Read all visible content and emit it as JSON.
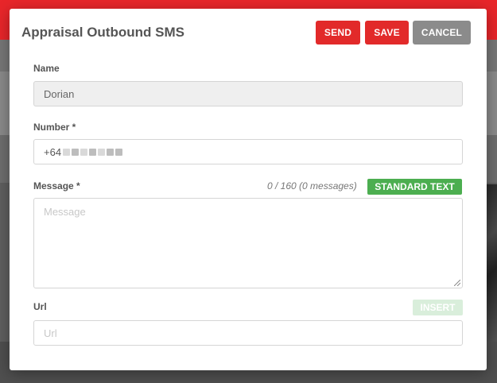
{
  "dialog": {
    "title": "Appraisal Outbound SMS",
    "buttons": {
      "send": "SEND",
      "save": "SAVE",
      "cancel": "CANCEL"
    }
  },
  "form": {
    "name": {
      "label": "Name",
      "value": "Dorian"
    },
    "number": {
      "label": "Number *",
      "value_visible_prefix": "+64"
    },
    "message": {
      "label": "Message *",
      "counter": "0 / 160 (0 messages)",
      "standard_text_button": "STANDARD TEXT",
      "placeholder": "Message"
    },
    "url": {
      "label": "Url",
      "insert_button": "INSERT",
      "placeholder": "Url"
    }
  },
  "colors": {
    "primary_red": "#e22a2a",
    "cancel_gray": "#8b8b8b",
    "standard_green": "#4cae50",
    "insert_disabled_green": "#d9eedb"
  }
}
